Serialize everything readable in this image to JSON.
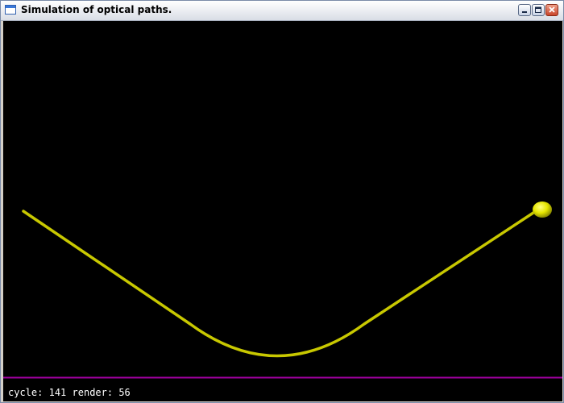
{
  "window": {
    "title": "Simulation of optical paths."
  },
  "status": {
    "cycle_label": "cycle:",
    "cycle_value": "141",
    "render_label": "render:",
    "render_value": "56"
  },
  "colors": {
    "background": "#000000",
    "path": "#c8c800",
    "ball": "#e6e600",
    "baseline": "#a000a0",
    "status_text": "#ffffff"
  },
  "icons": {
    "app": "window-icon",
    "minimize": "minimize-icon",
    "maximize": "maximize-icon",
    "close": "close-icon"
  }
}
